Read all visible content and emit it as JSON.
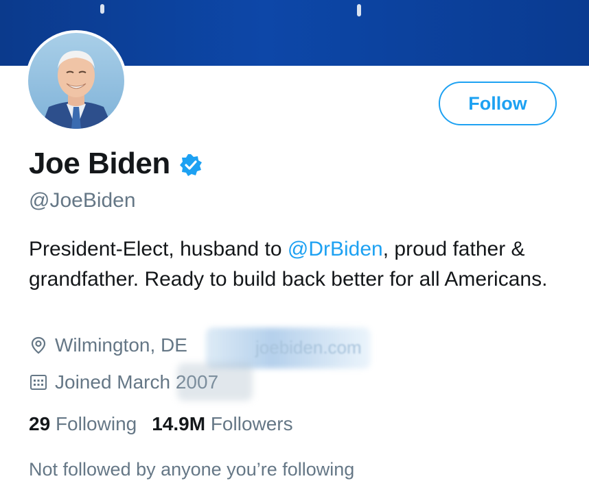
{
  "profile": {
    "name": "Joe Biden",
    "handle": "@JoeBiden",
    "verified": true,
    "bio_before": "President-Elect, husband to ",
    "bio_mention": "@DrBiden",
    "bio_after": ", proud father & grandfather. Ready to build back better for all Americans.",
    "location": "Wilmington, DE",
    "website": "joebiden.com",
    "joined": "Joined March 2007"
  },
  "actions": {
    "follow_label": "Follow"
  },
  "stats": {
    "following_count": "29",
    "following_label": "Following",
    "followers_count": "14.9M",
    "followers_label": "Followers"
  },
  "social_context": "Not followed by anyone you’re following",
  "colors": {
    "accent": "#1da1f2",
    "secondary_text": "#657786",
    "primary_text": "#14171a",
    "banner": "#0d47a8"
  },
  "icons": {
    "verified": "verified-badge-icon",
    "location": "location-pin-icon",
    "calendar": "calendar-icon"
  }
}
